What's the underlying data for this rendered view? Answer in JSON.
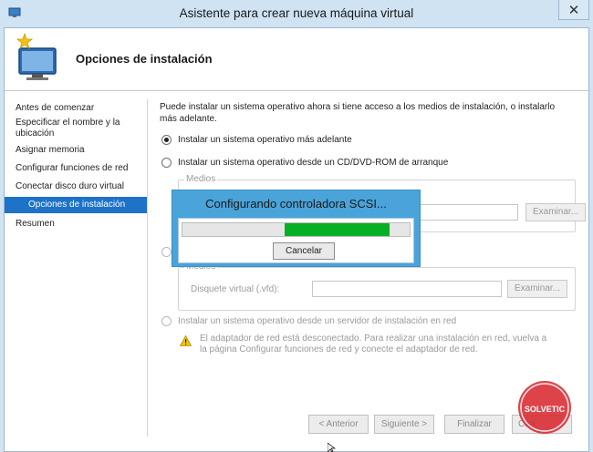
{
  "window": {
    "title": "Asistente para crear nueva máquina virtual",
    "close_glyph": "✕"
  },
  "header": {
    "title": "Opciones de instalación",
    "icon": "wizard-monitor-icon"
  },
  "nav": {
    "items": [
      {
        "label": "Antes de comenzar",
        "active": false
      },
      {
        "label": "Especificar el nombre y la ubicación",
        "active": false
      },
      {
        "label": "Asignar memoria",
        "active": false
      },
      {
        "label": "Configurar funciones de red",
        "active": false
      },
      {
        "label": "Conectar disco duro virtual",
        "active": false
      },
      {
        "label": "Opciones de instalación",
        "active": true
      },
      {
        "label": "Resumen",
        "active": false
      }
    ]
  },
  "content": {
    "intro": "Puede instalar un sistema operativo ahora si tiene acceso a los medios de instalación, o instalarlo más adelante.",
    "option_later": "Instalar un sistema operativo más adelante",
    "option_cd": "Instalar un sistema operativo desde un CD/DVD-ROM de arranque",
    "media_legend": "Medios",
    "browse_label": "Examinar...",
    "floppy_legend": "Medios",
    "floppy_label": "Disquete virtual (.vfd):",
    "floppy_browse": "Examinar...",
    "option_network": "Instalar un sistema operativo desde un servidor de instalación en red",
    "network_warning": "El adaptador de red está desconectado. Para realizar una instalación en red, vuelva a la página Configurar funciones de red y conecte el adaptador de red."
  },
  "buttons": {
    "previous": "< Anterior",
    "next": "Siguiente >",
    "finish": "Finalizar",
    "cancel_partial": "Can"
  },
  "progress_dialog": {
    "title": "Configurando controladora SCSI...",
    "cancel": "Cancelar",
    "indeterminate_fill_start": 0.45,
    "indeterminate_fill_end": 0.91
  },
  "colors": {
    "accent": "#1e72c8",
    "progress": "#06b025",
    "popup": "#4aa3d9",
    "watermark": "#d8222a"
  }
}
